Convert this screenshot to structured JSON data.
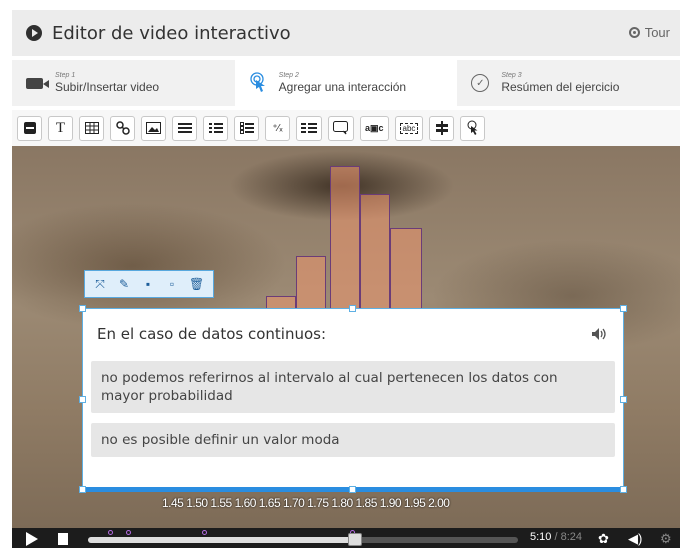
{
  "header": {
    "title": "Editor de video interactivo",
    "tour_label": "Tour"
  },
  "steps": [
    {
      "small": "Step 1",
      "label": "Subir/Insertar video"
    },
    {
      "small": "Step 2",
      "label": "Agregar una interacción"
    },
    {
      "small": "Step 3",
      "label": "Resúmen del ejercicio"
    }
  ],
  "toolbar": {
    "text_label": "T",
    "fill_label": "⁺⁄ₓ",
    "abc_label": "a▣c",
    "drag_label": "abc"
  },
  "card": {
    "question": "En el caso de datos continuos:",
    "options": [
      "no podemos referirnos al intervalo al cual pertenecen los datos con mayor probabilidad",
      "no es posible definir un valor moda"
    ]
  },
  "video": {
    "axis_text": "1.45 1.50 1.55 1.60 1.65 1.70 1.75 1.80 1.85 1.90 1.95 2.00"
  },
  "controls": {
    "current_time": "5:10",
    "separator": "/",
    "total_time": "8:24",
    "progress_fraction": 0.62
  },
  "colors": {
    "accent": "#2a8de0",
    "handle_border": "#5eb0e4",
    "bar_fill": "#ec966e",
    "bar_outline": "#6b3c78"
  },
  "icons": {
    "header": "play-circle-icon",
    "tour": "target-icon",
    "step1": "video-camera-icon",
    "step2": "touch-icon",
    "step3": "check-circle-icon",
    "speaker": "speaker-icon"
  }
}
